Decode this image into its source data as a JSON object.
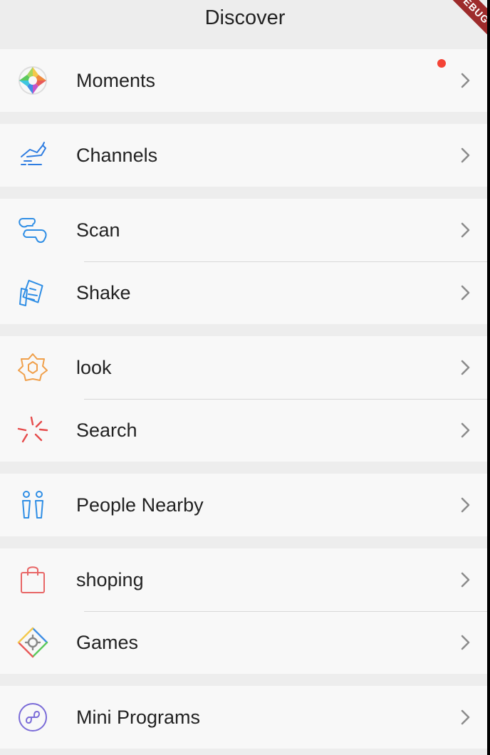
{
  "header": {
    "title": "Discover",
    "banner": "DEBUG"
  },
  "groups": [
    {
      "items": [
        {
          "label": "Moments",
          "icon": "moments-icon",
          "badge_dot": true
        }
      ]
    },
    {
      "items": [
        {
          "label": "Channels",
          "icon": "channels-icon"
        }
      ]
    },
    {
      "items": [
        {
          "label": "Scan",
          "icon": "scan-icon"
        },
        {
          "label": "Shake",
          "icon": "shake-icon"
        }
      ]
    },
    {
      "items": [
        {
          "label": "look",
          "icon": "look-icon"
        },
        {
          "label": "Search",
          "icon": "search-icon"
        }
      ]
    },
    {
      "items": [
        {
          "label": "People Nearby",
          "icon": "people-nearby-icon"
        }
      ]
    },
    {
      "items": [
        {
          "label": "shoping",
          "icon": "shopping-bag-icon"
        },
        {
          "label": "Games",
          "icon": "games-icon"
        }
      ]
    },
    {
      "items": [
        {
          "label": "Mini Programs",
          "icon": "mini-programs-icon"
        }
      ]
    }
  ],
  "colors": {
    "background": "#ededed",
    "row_background": "#f8f8f8",
    "text": "#222222",
    "chevron": "#8c8c8c",
    "badge_dot": "#f44336",
    "channels_icon": "#2f7de1",
    "scan_icon": "#2f8ee5",
    "look_icon": "#f0a04b",
    "search_icon": "#e64b4b",
    "people_icon": "#2f8ee5",
    "shopping_icon": "#e86666",
    "mini_programs_icon": "#7b6cd8"
  }
}
